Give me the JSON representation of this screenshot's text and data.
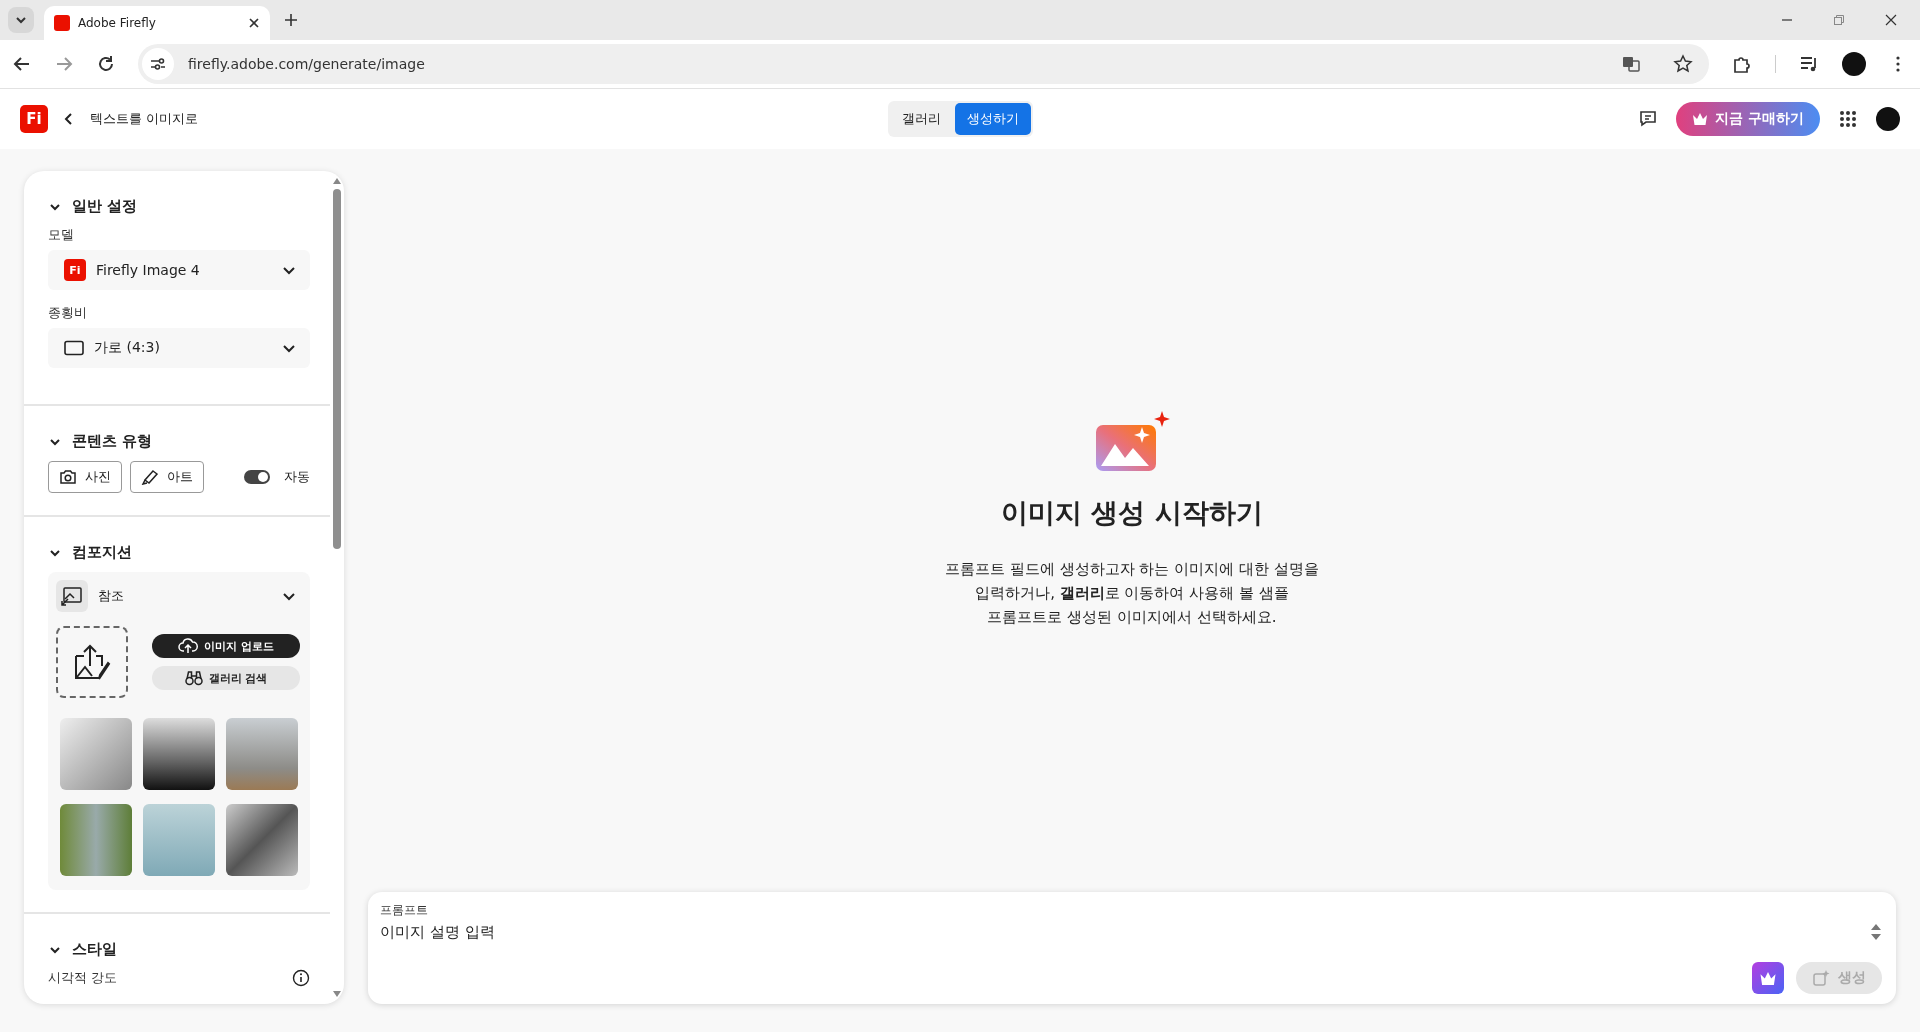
{
  "browser": {
    "tab_title": "Adobe Firefly",
    "url": "firefly.adobe.com/generate/image"
  },
  "header": {
    "logo": "Fi",
    "back_label": "텍스트를 이미지로",
    "buy_button": "지금 구매하기",
    "tabs": [
      {
        "label": "갤러리",
        "selected": false
      },
      {
        "label": "생성하기",
        "selected": true
      }
    ]
  },
  "general": {
    "title": "일반 설정",
    "expanded": true,
    "model_label": "모델",
    "model_logo": "Fi",
    "model_value": "Firefly Image 4",
    "ratio_label": "종횡비",
    "ratio_value": "가로 (4:3)"
  },
  "content_type": {
    "title": "콘텐츠 유형",
    "expanded": true,
    "auto_label": "자동",
    "auto_on": true,
    "options": [
      {
        "label": "사진",
        "kind": "photo",
        "selected": false
      },
      {
        "label": "아트",
        "kind": "art",
        "selected": false
      }
    ]
  },
  "composition": {
    "title": "컴포지션",
    "expanded": true,
    "reference_label": "참조",
    "upload_button": "이미지 업로드",
    "gallery_button": "갤러리 검색"
  },
  "style": {
    "title": "스타일",
    "expanded": true,
    "intensity_label": "시각적 강도"
  },
  "empty_state": {
    "title": "이미지 생성 시작하기",
    "description": "프롬프트 필드에 생성하고자 하는 이미지에 대한 설명을\n입력하거나, **갤러리**로 이동하여 사용해 볼 샘플\n프롬프트로 생성된 이미지에서 선택하세요."
  },
  "prompt": {
    "label": "프롬프트",
    "placeholder": "이미지 설명 입력",
    "generate_button": "생성",
    "generate_disabled": true
  }
}
